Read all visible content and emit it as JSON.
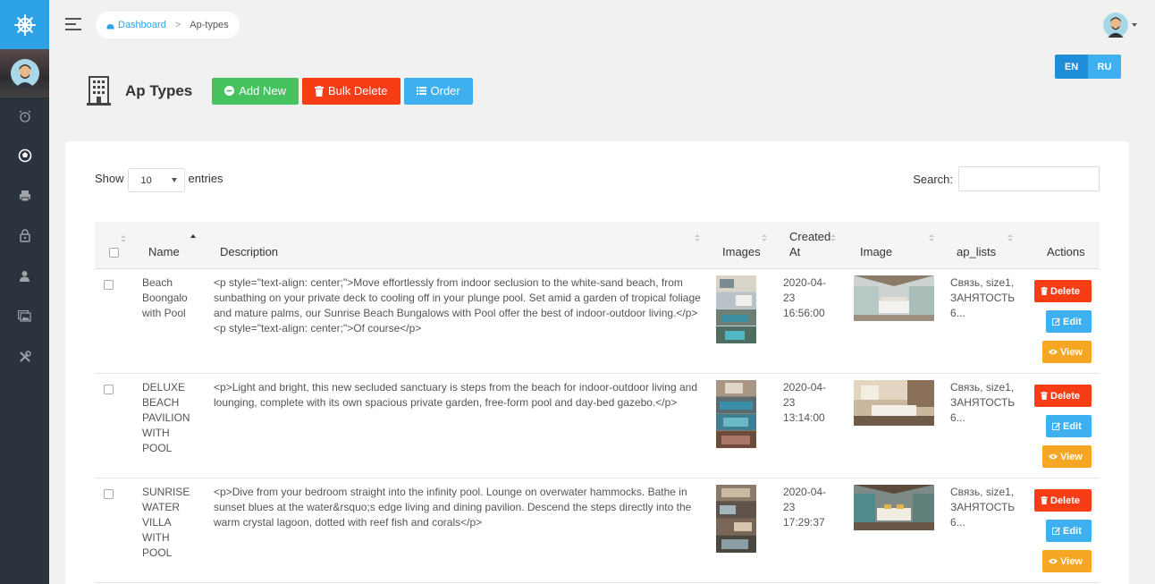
{
  "topbar": {
    "breadcrumb": {
      "home": "Dashboard",
      "current": "Ap-types"
    }
  },
  "lang": {
    "en": "EN",
    "ru": "RU"
  },
  "page": {
    "title": "Ap Types",
    "add_label": "Add New",
    "bulk_label": "Bulk Delete",
    "order_label": "Order"
  },
  "table_controls": {
    "show_label": "Show",
    "entries_label": "entries",
    "page_size": "10",
    "search_label": "Search:"
  },
  "table": {
    "headers": {
      "name": "Name",
      "description": "Description",
      "images": "Images",
      "created_at_1": "Created",
      "created_at_2": "At",
      "image": "Image",
      "ap_lists": "ap_lists",
      "actions": "Actions"
    },
    "action_labels": {
      "delete": "Delete",
      "edit": "Edit",
      "view": "View"
    },
    "rows": [
      {
        "name": "Beach Boongalo with Pool",
        "description": "<p style=\"text-align: center;\">Move effortlessly from indoor seclusion to the white-sand beach, from sunbathing on your private deck to cooling off in your plunge pool. Set amid a garden of tropical foliage and mature palms, our Sunrise Beach Bungalows with Pool offer the best of indoor-outdoor living.</p> <p style=\"text-align: center;\">Of course</p>",
        "created_1": "2020-04-",
        "created_2": "23",
        "created_3": "16:56:00",
        "ap_lists": "Связь, size1, ЗАНЯТОСТЬ 6..."
      },
      {
        "name": "DELUXE BEACH PAVILION WITH POOL",
        "description": "<p>Light and bright, this new secluded sanctuary is steps from the beach for indoor-outdoor living and lounging, complete with its own spacious private garden, free-form pool and day-bed gazebo.</p>",
        "created_1": "2020-04-",
        "created_2": "23",
        "created_3": "13:14:00",
        "ap_lists": "Связь, size1, ЗАНЯТОСТЬ 6..."
      },
      {
        "name": "SUNRISE WATER VILLA WITH POOL",
        "description": "<p>Dive from your bedroom straight into the infinity pool. Lounge on overwater hammocks. Bathe in sunset blues at the water&rsquo;s edge living and dining pavilion. Descend the steps directly into the warm crystal lagoon, dotted with reef fish and corals</p>",
        "created_1": "2020-04-",
        "created_2": "23",
        "created_3": "17:29:37",
        "ap_lists": "Связь, size1, ЗАНЯТОСТЬ 6..."
      }
    ]
  },
  "colors": {
    "sidebar": "#2b333e",
    "brand": "#2ea2e7",
    "add": "#46c35f",
    "danger": "#f63d16",
    "info": "#3fb0ef",
    "warning": "#f5a623"
  }
}
